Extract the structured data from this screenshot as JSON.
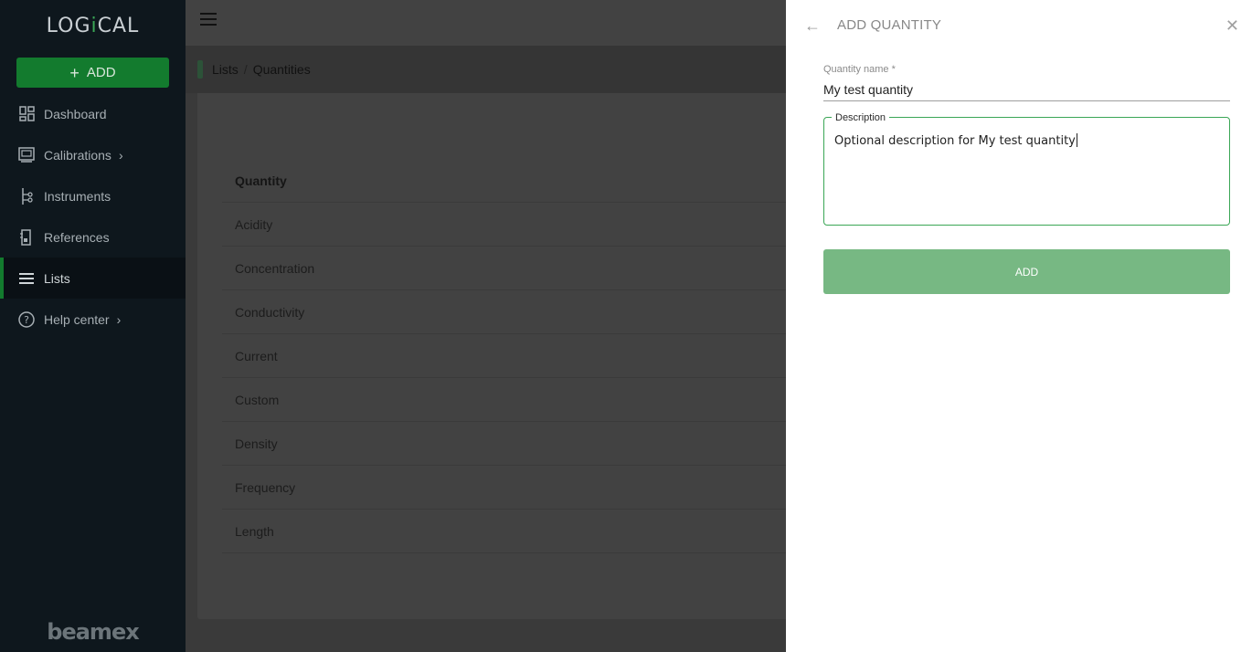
{
  "app": {
    "logo_left": "LOG",
    "logo_i": "i",
    "logo_right": "CAL",
    "brand": "beamex"
  },
  "sidebar": {
    "add_label": "ADD",
    "items": [
      {
        "label": "Dashboard",
        "icon": "dashboard-icon"
      },
      {
        "label": "Calibrations",
        "icon": "calibrations-icon"
      },
      {
        "label": "Instruments",
        "icon": "instruments-icon"
      },
      {
        "label": "References",
        "icon": "references-icon"
      },
      {
        "label": "Lists",
        "icon": "lists-icon"
      },
      {
        "label": "Help center",
        "icon": "help-icon"
      }
    ]
  },
  "breadcrumb": {
    "root": "Lists",
    "separator": "/",
    "current": "Quantities"
  },
  "table": {
    "header": "Quantity",
    "rows": [
      "Acidity",
      "Concentration",
      "Conductivity",
      "Current",
      "Custom",
      "Density",
      "Frequency",
      "Length"
    ]
  },
  "drawer": {
    "title": "ADD QUANTITY",
    "name_label": "Quantity name *",
    "name_value": "My test quantity",
    "description_label": "Description",
    "description_value": "Optional description for My test quantity",
    "submit_label": "ADD"
  },
  "colors": {
    "accent": "#137b2e",
    "sidebar_bg": "#0e171d",
    "submit_bg": "#77b883"
  }
}
